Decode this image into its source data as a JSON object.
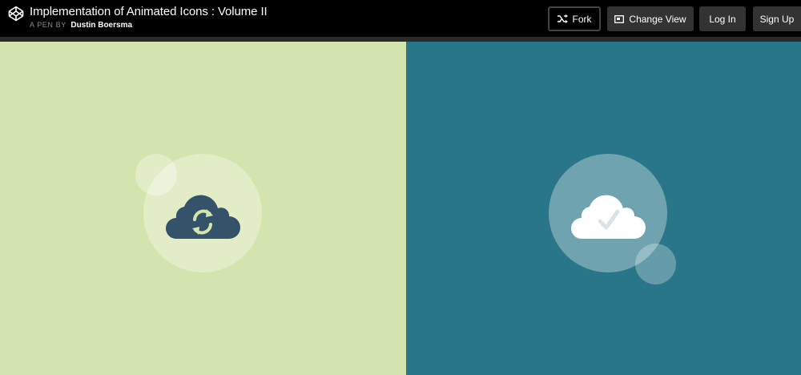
{
  "header": {
    "title": "Implementation of Animated Icons : Volume II",
    "byline_prefix": "A PEN BY",
    "author": "Dustin Boersma",
    "logo_icon": "codepen-logo-icon"
  },
  "toolbar": {
    "fork_label": "Fork",
    "fork_icon": "fork-icon",
    "change_view_label": "Change View",
    "change_view_icon": "window-icon",
    "login_label": "Log In",
    "signup_label": "Sign Up"
  },
  "panels": {
    "left": {
      "background": "#d4e4ae",
      "icon": "cloud-sync-icon",
      "cloud_color": "#34526a",
      "arrows_color": "#d4e4ae"
    },
    "right": {
      "background": "#2a7689",
      "icon": "cloud-check-icon",
      "cloud_color": "#ffffff",
      "check_color": "#d9e3e7"
    }
  }
}
